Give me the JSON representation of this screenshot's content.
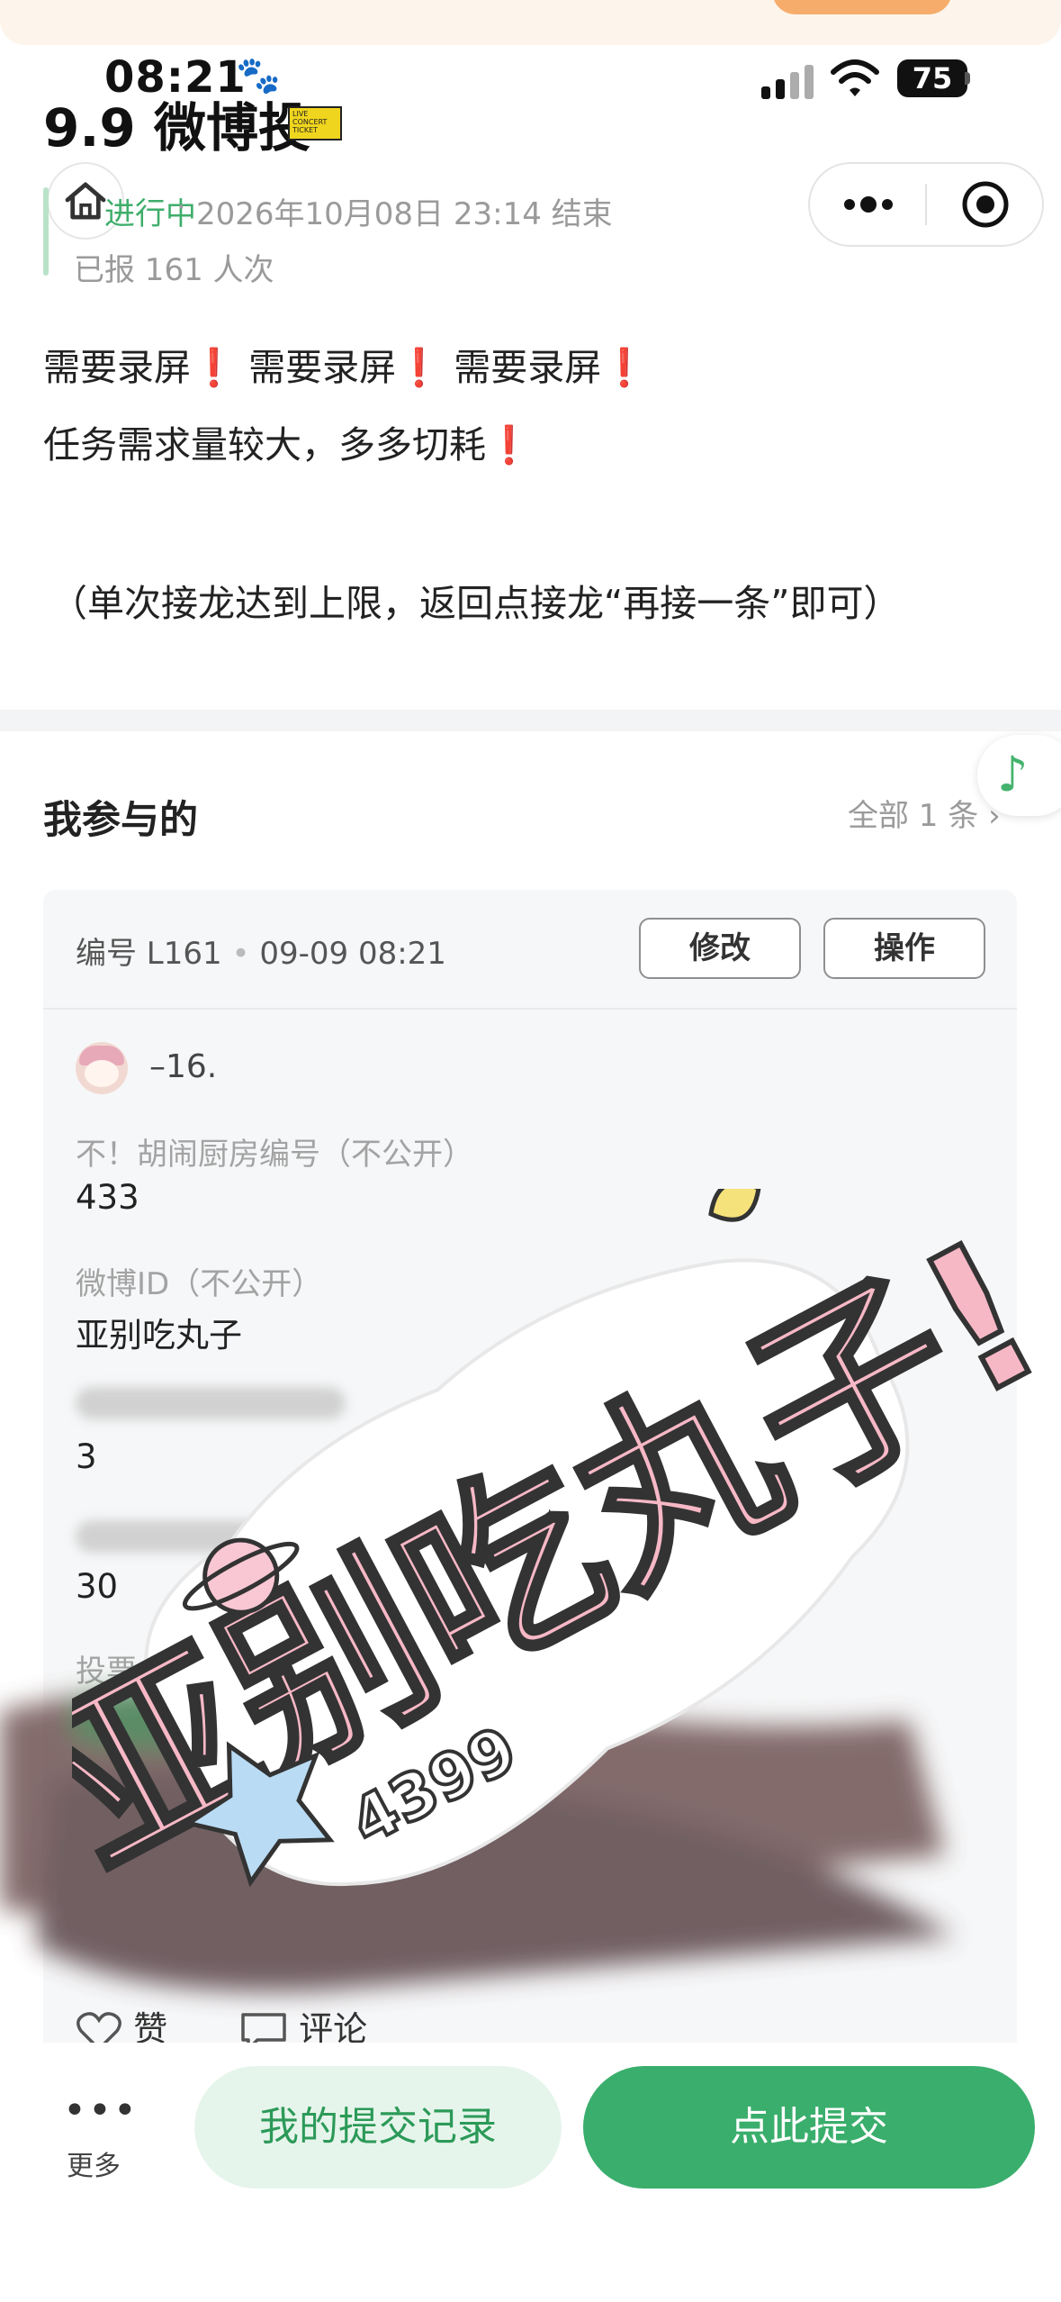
{
  "status_bar": {
    "time": "08:21",
    "battery": "75"
  },
  "header": {
    "title": "9.9 微博投",
    "ticket_text": "LIVE CONCERT TICKET"
  },
  "event": {
    "status": "进行中",
    "separator": "·",
    "end_time": "2026年10月08日 23:14 结束",
    "reported": "已报 161 人次"
  },
  "description": {
    "line1_parts": [
      "需要录屏",
      "需要录屏",
      "需要录屏"
    ],
    "mark": "❗",
    "line2": "任务需求量较大，多多切耗",
    "line3": "（单次接龙达到上限，返回点接龙“再接一条”即可）"
  },
  "my_section": {
    "title": "我参与的",
    "all_link": "全部 1 条",
    "chevron": "›"
  },
  "entry": {
    "number": "编号 L161",
    "dot": "•",
    "time": "09-09 08:21",
    "edit_label": "修改",
    "action_label": "操作",
    "username": "–16.",
    "fields": [
      {
        "label": "不！胡闹厨房编号（不公开）",
        "value": "433"
      },
      {
        "label": "微博ID（不公开）",
        "value": "亚别吃丸子"
      },
      {
        "label": "",
        "value": "3"
      },
      {
        "label": "",
        "value": "30"
      },
      {
        "label": "投票",
        "value": ""
      }
    ],
    "like_label": "赞",
    "comment_label": "评论"
  },
  "sticker": {
    "main_text": "亚别吃丸子!",
    "sub_text": "4399"
  },
  "bottom": {
    "more_icon": "•••",
    "more_label": "更多",
    "records_label": "我的提交记录",
    "submit_label": "点此提交"
  },
  "colors": {
    "green": "#3aae6c",
    "green_light": "#e6f5ec",
    "status_green": "#3fae6b",
    "red": "#e02020"
  }
}
